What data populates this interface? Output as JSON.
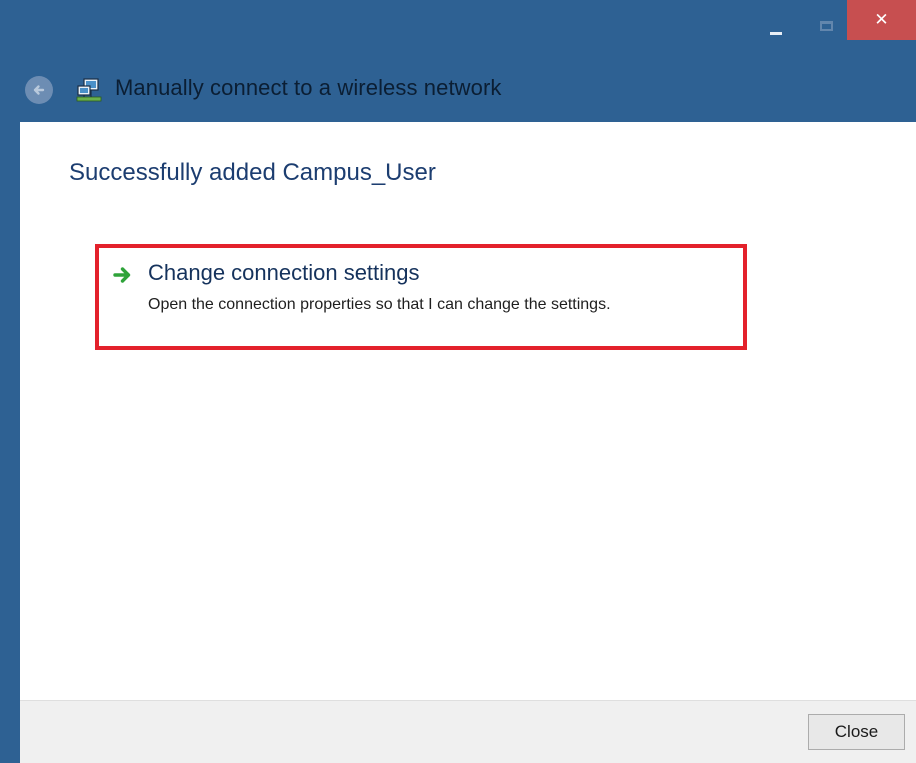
{
  "window": {
    "title": "Manually connect to a wireless network",
    "controls": {
      "minimize_icon": "minimize-icon",
      "maximize_icon": "maximize-icon",
      "close_icon": "close-icon",
      "close_glyph": "✕"
    },
    "back_icon": "back-arrow-icon",
    "app_icon": "network-icon"
  },
  "main": {
    "heading": "Successfully added Campus_User",
    "command_link": {
      "icon": "green-arrow-icon",
      "title": "Change connection settings",
      "description": "Open the connection properties so that I can change the settings."
    }
  },
  "footer": {
    "close_label": "Close"
  },
  "colors": {
    "titlebar": "#2e6193",
    "close_button_bg": "#c74f50",
    "heading_text": "#1c3d70",
    "highlight_border": "#e3212b",
    "arrow_green": "#2fa33a",
    "footer_bg": "#f0f0f0"
  }
}
